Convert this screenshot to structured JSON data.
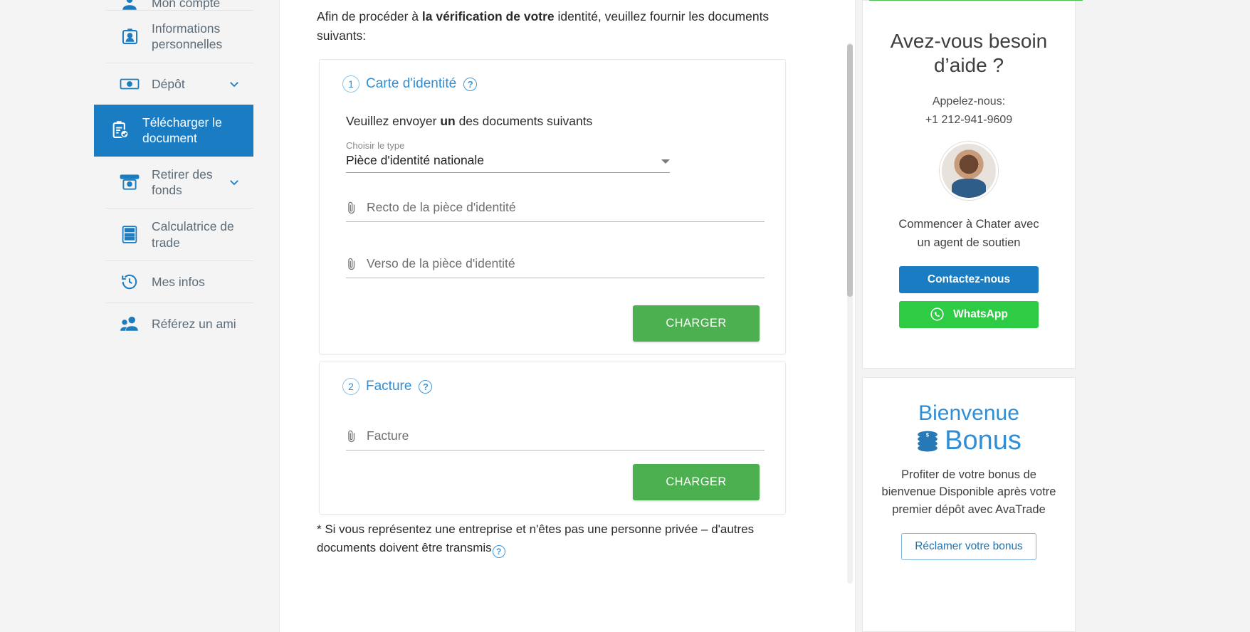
{
  "sidebar": {
    "items": [
      {
        "label": "Mon compte",
        "icon": "user-icon",
        "chevron": false,
        "active": false,
        "partial": true
      },
      {
        "label": "Informations personnelles",
        "icon": "id-badge-icon",
        "chevron": false,
        "active": false
      },
      {
        "label": "Dépôt",
        "icon": "banknote-icon",
        "chevron": true,
        "active": false
      },
      {
        "label": "Télécharger le document",
        "icon": "clipboard-check-icon",
        "chevron": false,
        "active": true
      },
      {
        "label": "Retirer des fonds",
        "icon": "atm-withdraw-icon",
        "chevron": true,
        "active": false
      },
      {
        "label": "Calculatrice de trade",
        "icon": "calculator-icon",
        "chevron": false,
        "active": false
      },
      {
        "label": "Mes infos",
        "icon": "history-clock-icon",
        "chevron": false,
        "active": false
      },
      {
        "label": "Référez un ami",
        "icon": "people-icon",
        "chevron": false,
        "active": false
      }
    ]
  },
  "main": {
    "intro_before": "Afin de procéder à ",
    "intro_bold": "la vérification de votre",
    "intro_after": " identité, veuillez fournir les documents suivants:",
    "card_id": {
      "step": "1",
      "title": "Carte d'identité",
      "help_icon": "question-mark-icon",
      "subtitle_before": "Veuillez envoyer ",
      "subtitle_bold": "un",
      "subtitle_after": " des documents suivants",
      "select_label": "Choisir le type",
      "select_value": "Pièce d'identité nationale",
      "select_options": [
        "Pièce d'identité nationale"
      ],
      "file_front_placeholder": "Recto de la pièce d'identité",
      "file_back_placeholder": "Verso de la pièce d'identité",
      "upload_label": "CHARGER"
    },
    "card_bill": {
      "step": "2",
      "title": "Facture",
      "help_icon": "question-mark-icon",
      "file_placeholder": "Facture",
      "upload_label": "CHARGER"
    },
    "footnote": "* Si vous représentez une entreprise et n'êtes pas une personne privée – d'autres documents doivent être transmis"
  },
  "help_panel": {
    "title": "Avez-vous besoin d’aide ?",
    "call_label": "Appelez-nous:",
    "phone": "+1 212-941-9609",
    "avatar": "support-agent-avatar",
    "chat_text": "Commencer à Chater avec un agent de soutien",
    "contact_label": "Contactez-nous",
    "whatsapp_label": "WhatsApp",
    "whatsapp_icon": "whatsapp-icon"
  },
  "bonus_panel": {
    "title_line1": "Bienvenue",
    "title_line2": "Bonus",
    "coins_icon": "coins-stack-icon",
    "text": "Profiter de votre bonus de bienvenue Disponible après votre premier dépôt avec AvaTrade",
    "button_label": "Réclamer votre bonus"
  },
  "colors": {
    "brand_blue": "#1a7cc2",
    "link_blue": "#2f8ed6",
    "green": "#4caf50",
    "whatsapp_green": "#2ecc45",
    "page_bg": "#f3f3f3"
  }
}
